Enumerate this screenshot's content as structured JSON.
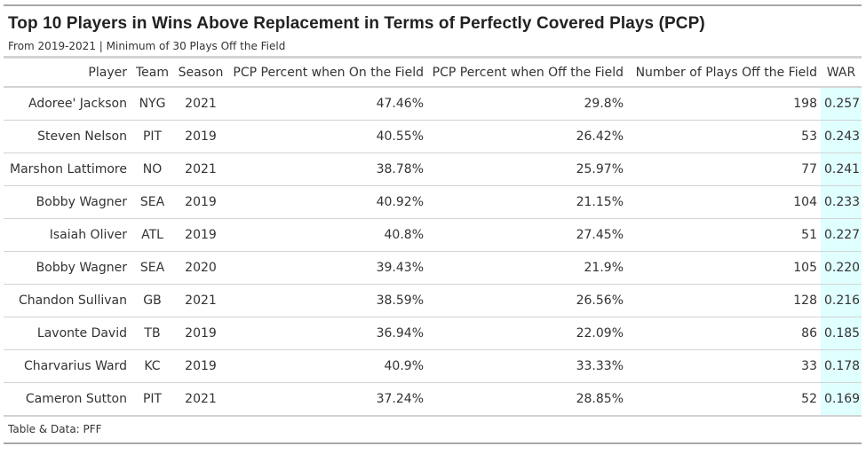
{
  "colors": {
    "war_highlight": "#e0ffff",
    "rule_dark": "#a8a8a8",
    "rule_light": "#d3d3d3",
    "text": "#333333"
  },
  "title": "Top 10 Players in Wins Above Replacement in Terms of Perfectly Covered Plays (PCP)",
  "subtitle": "From 2019-2021 | Minimum of 30 Plays Off the Field",
  "footer": "Table & Data: PFF",
  "chart_data": {
    "type": "table",
    "title": "Top 10 Players in Wins Above Replacement in Terms of Perfectly Covered Plays (PCP)",
    "subtitle": "From 2019-2021 | Minimum of 30 Plays Off the Field",
    "source": "Table & Data: PFF",
    "columns": [
      "Player",
      "Team",
      "Season",
      "PCP Percent when On the Field",
      "PCP Percent when Off the Field",
      "Number of Plays Off the Field",
      "WAR"
    ],
    "rows": [
      [
        "Adoree' Jackson",
        "NYG",
        "2021",
        "47.46%",
        "29.8%",
        "198",
        "0.257"
      ],
      [
        "Steven Nelson",
        "PIT",
        "2019",
        "40.55%",
        "26.42%",
        "53",
        "0.243"
      ],
      [
        "Marshon Lattimore",
        "NO",
        "2021",
        "38.78%",
        "25.97%",
        "77",
        "0.241"
      ],
      [
        "Bobby Wagner",
        "SEA",
        "2019",
        "40.92%",
        "21.15%",
        "104",
        "0.233"
      ],
      [
        "Isaiah Oliver",
        "ATL",
        "2019",
        "40.8%",
        "27.45%",
        "51",
        "0.227"
      ],
      [
        "Bobby Wagner",
        "SEA",
        "2020",
        "39.43%",
        "21.9%",
        "105",
        "0.220"
      ],
      [
        "Chandon Sullivan",
        "GB",
        "2021",
        "38.59%",
        "26.56%",
        "128",
        "0.216"
      ],
      [
        "Lavonte David",
        "TB",
        "2019",
        "36.94%",
        "22.09%",
        "86",
        "0.185"
      ],
      [
        "Charvarius Ward",
        "KC",
        "2019",
        "40.9%",
        "33.33%",
        "33",
        "0.178"
      ],
      [
        "Cameron Sutton",
        "PIT",
        "2021",
        "37.24%",
        "28.85%",
        "52",
        "0.169"
      ]
    ]
  }
}
